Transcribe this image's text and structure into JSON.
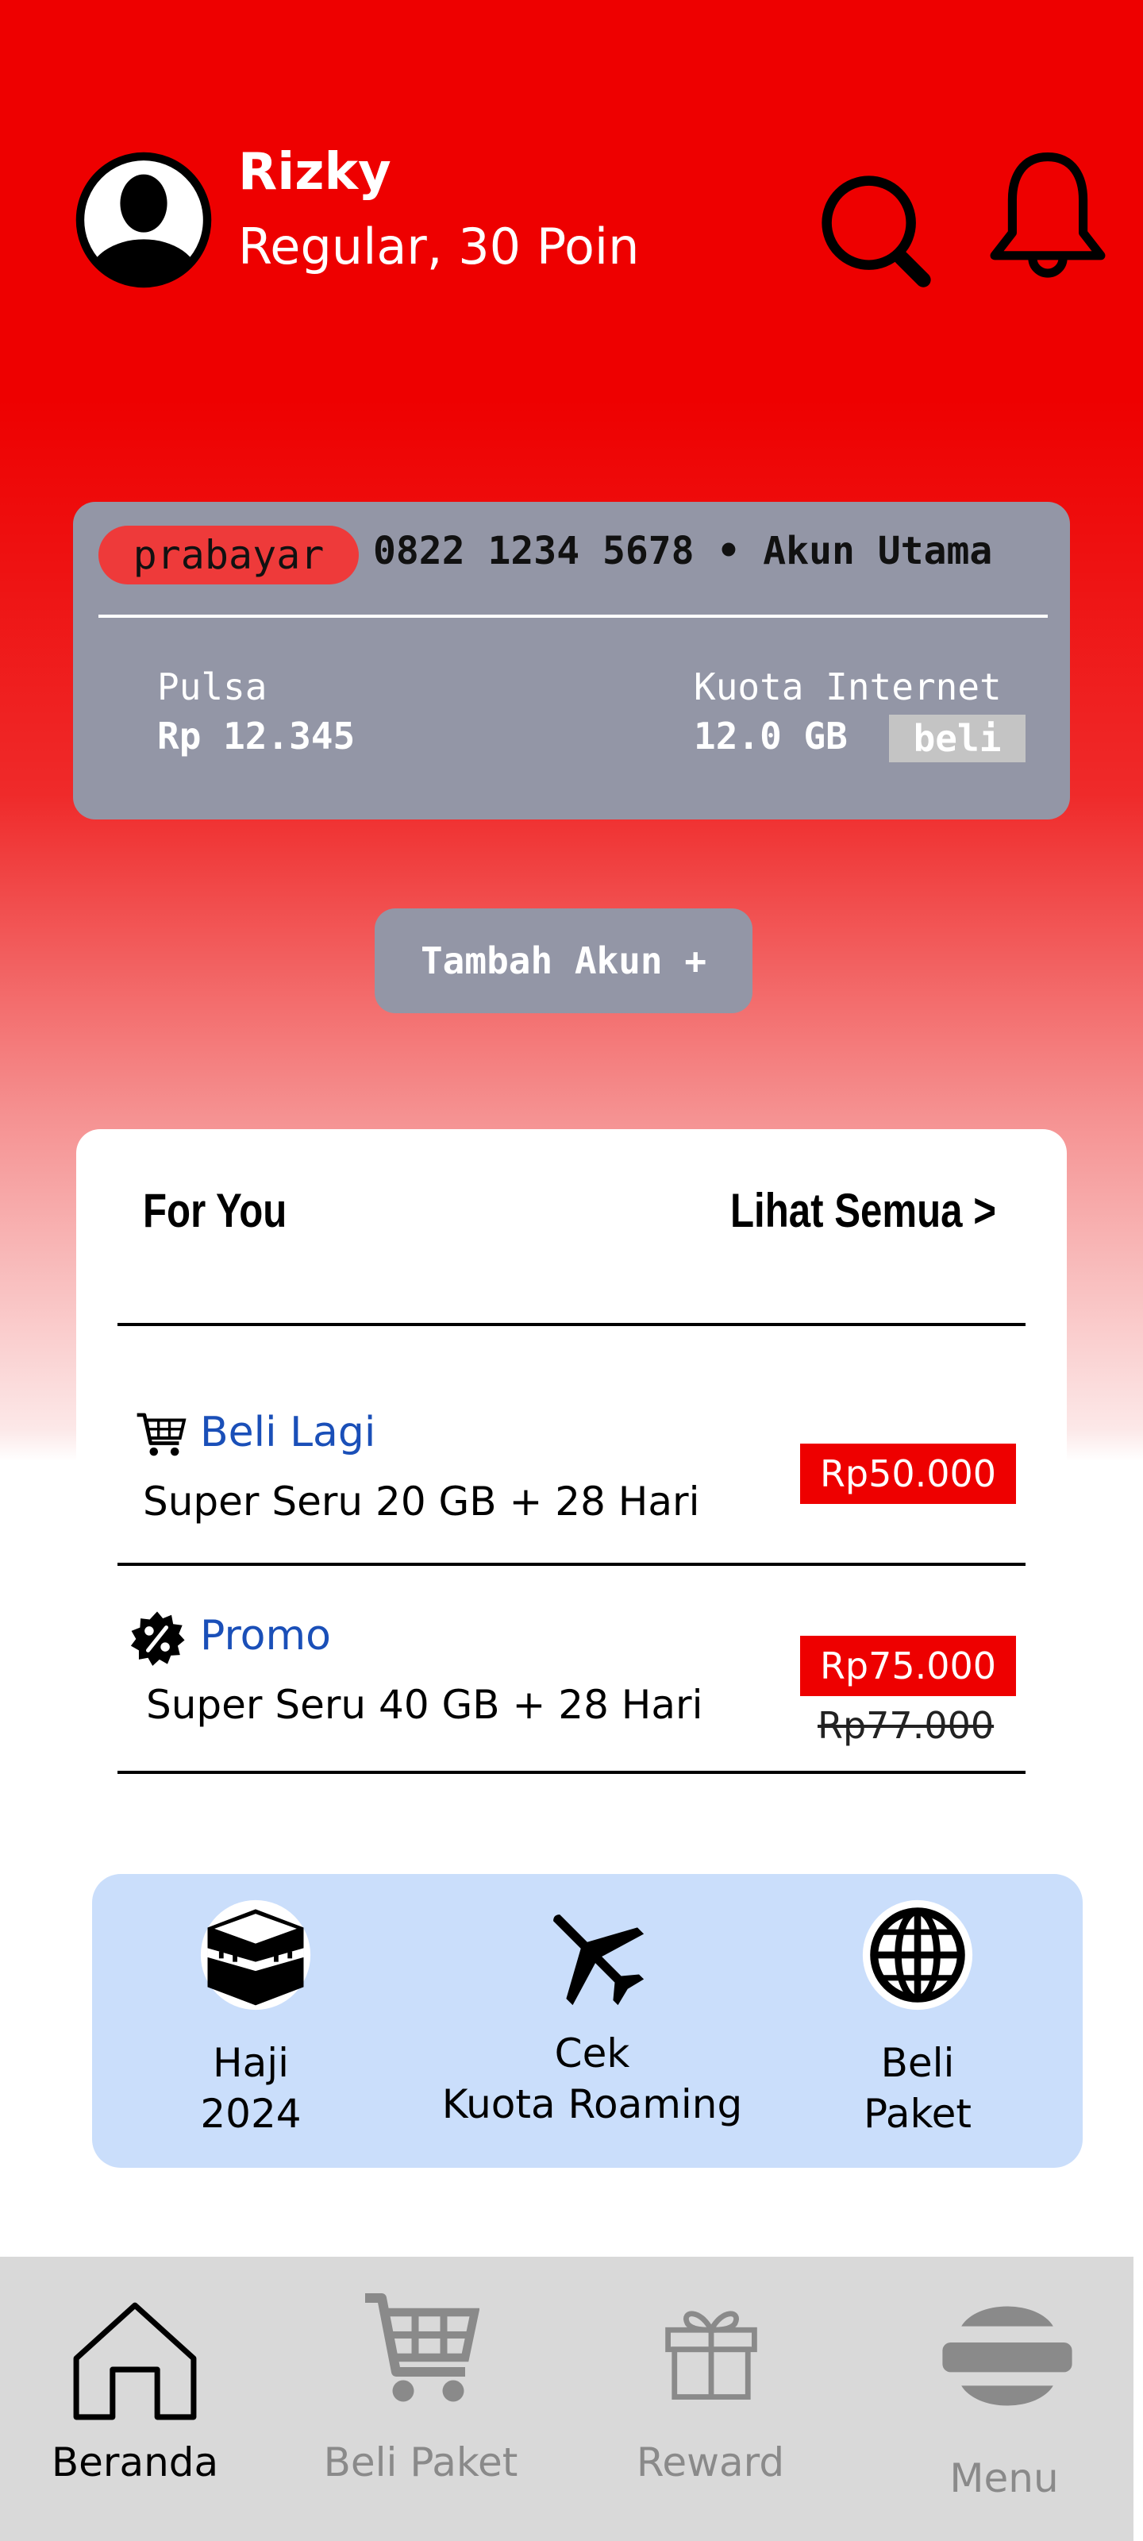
{
  "header": {
    "user_name": "Rizky",
    "user_tier": "Regular, 30 Poin",
    "icons": [
      "avatar-icon",
      "search-icon",
      "bell-icon"
    ]
  },
  "account": {
    "type": "prabayar",
    "number_line": "0822 1234 5678 • Akun Utama",
    "pulsa_label": "Pulsa",
    "pulsa_value": "Rp 12.345",
    "kuota_label": "Kuota Internet",
    "kuota_value": "12.0 GB",
    "beli_label": "beli"
  },
  "tambah_akun": "Tambah Akun +",
  "for_you": {
    "title": "For You",
    "see_all": "Lihat Semua >",
    "items": [
      {
        "tag": "Beli Lagi",
        "tag_icon": "cart-icon",
        "name": "Super Seru 20 GB + 28 Hari",
        "price": "Rp50.000"
      },
      {
        "tag": "Promo",
        "tag_icon": "discount-badge-icon",
        "name": "Super Seru 40 GB + 28 Hari",
        "price": "Rp75.000",
        "old_price": "Rp77.000"
      }
    ]
  },
  "quick_actions": [
    {
      "icon": "kaaba-icon",
      "line1": "Haji",
      "line2": "2024"
    },
    {
      "icon": "airplane-icon",
      "line1": "Cek",
      "line2": "Kuota Roaming"
    },
    {
      "icon": "globe-icon",
      "line1": "Beli",
      "line2": "Paket"
    }
  ],
  "bottom_nav": [
    {
      "icon": "home-icon",
      "label": "Beranda",
      "active": true
    },
    {
      "icon": "cart-icon",
      "label": "Beli Paket",
      "active": false
    },
    {
      "icon": "gift-icon",
      "label": "Reward",
      "active": false
    },
    {
      "icon": "menu-icon",
      "label": "Menu",
      "active": false
    }
  ],
  "colors": {
    "brand_red": "#ee0000",
    "card_gray": "#9396a6",
    "link_blue": "#1a4fb8",
    "panel_blue": "#cadefb",
    "nav_bg": "#d9d9d9",
    "nav_inactive": "#8a8a8a"
  }
}
